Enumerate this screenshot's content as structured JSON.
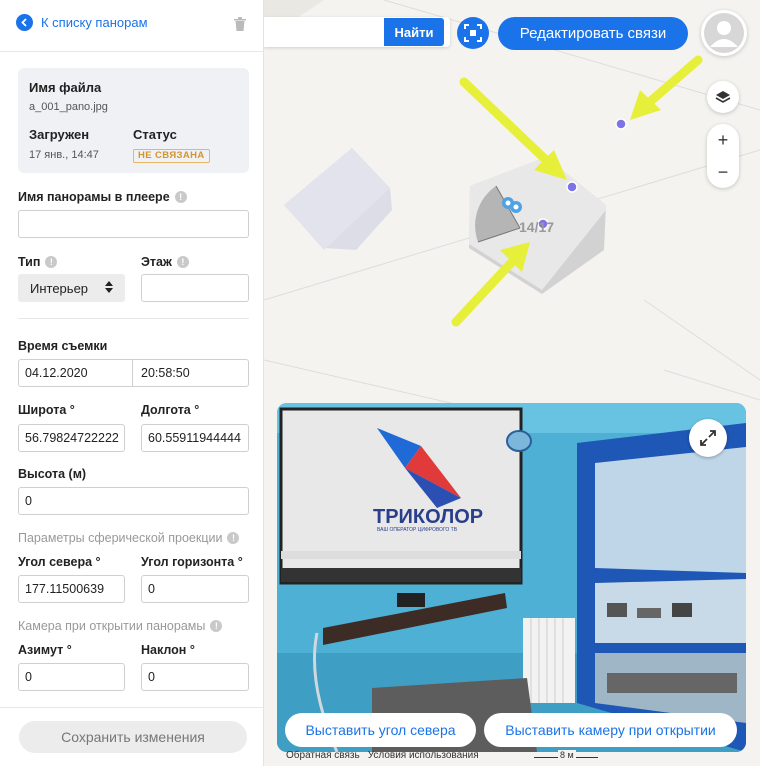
{
  "sidebar": {
    "back_label": "К списку панорам",
    "file": {
      "filename_label": "Имя файла",
      "filename_value": "a_001_pano.jpg",
      "uploaded_label": "Загружен",
      "uploaded_value": "17 янв., 14:47",
      "status_label": "Статус",
      "status_value": "НЕ СВЯЗАНА"
    },
    "player_name_label": "Имя панорамы в плеере",
    "player_name_value": "",
    "type_label": "Тип",
    "type_value": "Интерьер",
    "floor_label": "Этаж",
    "floor_value": "",
    "shoot_time_label": "Время съемки",
    "date_value": "04.12.2020",
    "time_value": "20:58:50",
    "lat_label": "Широта °",
    "lat_value": "56.79824722222",
    "lon_label": "Долгота °",
    "lon_value": "60.55911944444",
    "height_label": "Высота (м)",
    "height_value": "0",
    "sphere_section": "Параметры сферической проекции",
    "north_angle_label": "Угол севера °",
    "north_angle_value": "177.11500639",
    "horizon_angle_label": "Угол горизонта °",
    "horizon_angle_value": "0",
    "camera_section": "Камера при открытии панорамы",
    "azimuth_label": "Азимут °",
    "azimuth_value": "0",
    "tilt_label": "Наклон °",
    "tilt_value": "0",
    "save_label": "Сохранить изменения"
  },
  "topbar": {
    "search_value": "",
    "find_label": "Найти",
    "edit_links_label": "Редактировать связи"
  },
  "map": {
    "building_number": "14/17",
    "zoom_in": "+",
    "zoom_out": "−",
    "footer_feedback": "Обратная связь",
    "footer_terms": "Условия использования",
    "scale_label": "8 м"
  },
  "pano": {
    "brand_text": "ТРИКОЛОР",
    "brand_sub": "ВАШ ОПЕРАТОР ЦИФРОВОГО ТВ",
    "set_north_label": "Выставить угол севера",
    "set_camera_label": "Выставить камеру при открытии"
  },
  "colors": {
    "accent": "#1a73e8",
    "status_badge": "#d6932b",
    "marker": "#7b73e6",
    "arrow": "#e6f03a"
  }
}
